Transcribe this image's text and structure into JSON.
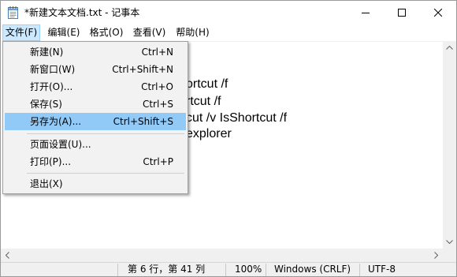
{
  "window": {
    "title": "*新建文本文档.txt - 记事本",
    "icon": "notepad-icon"
  },
  "menubar": {
    "items": [
      {
        "label": "文件(F)",
        "active": true
      },
      {
        "label": "编辑(E)"
      },
      {
        "label": "格式(O)"
      },
      {
        "label": "查看(V)"
      },
      {
        "label": "帮助(H)"
      }
    ]
  },
  "editor": {
    "visible_lines": [
      "ortcut /f",
      "rtcut /f",
      "cut /v IsShortcut /f",
      "explorer"
    ]
  },
  "file_menu": {
    "items": [
      {
        "label": "新建(N)",
        "shortcut": "Ctrl+N"
      },
      {
        "label": "新窗口(W)",
        "shortcut": "Ctrl+Shift+N"
      },
      {
        "label": "打开(O)...",
        "shortcut": "Ctrl+O"
      },
      {
        "label": "保存(S)",
        "shortcut": "Ctrl+S"
      },
      {
        "label": "另存为(A)...",
        "shortcut": "Ctrl+Shift+S",
        "highlighted": true
      },
      {
        "label": "页面设置(U)...",
        "shortcut": ""
      },
      {
        "label": "打印(P)...",
        "shortcut": "Ctrl+P"
      },
      {
        "label": "退出(X)",
        "shortcut": ""
      }
    ]
  },
  "statusbar": {
    "position": "第 6 行，第 41 列",
    "zoom": "100%",
    "line_ending": "Windows (CRLF)",
    "encoding": "UTF-8"
  },
  "colors": {
    "menu_active_bg": "#cce8ff",
    "menu_highlight_bg": "#91c9f7",
    "chrome_bg": "#f0f0f0"
  }
}
